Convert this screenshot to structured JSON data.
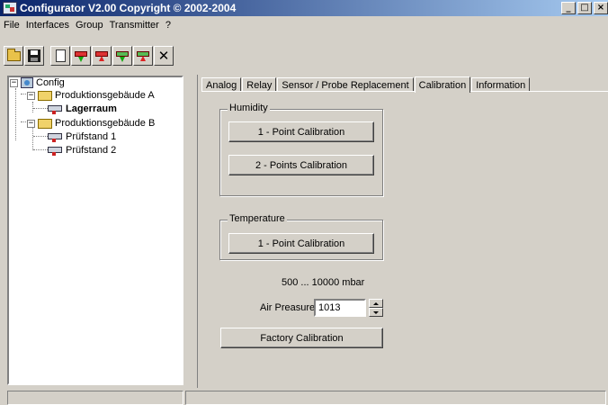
{
  "window": {
    "title": "Configurator  V2.00 Copyright © 2002-2004",
    "controls": {
      "minimize": "_",
      "maximize": "□",
      "close": "×"
    }
  },
  "menu": [
    "File",
    "Interfaces",
    "Group",
    "Transmitter",
    "?"
  ],
  "toolbar": {
    "buttons": [
      "open-folder-icon",
      "save-disk-icon",
      "new-document-icon",
      "download-device-icon",
      "upload-device-icon",
      "device-in-icon",
      "device-out-icon",
      "delete-icon"
    ]
  },
  "tree": {
    "root": {
      "label": "Config",
      "expander": "−"
    },
    "groups": [
      {
        "label": "Produktionsgebäude A",
        "expander": "−",
        "items": [
          {
            "label": "Lagerraum",
            "selected": true
          }
        ]
      },
      {
        "label": "Produktionsgebäude B",
        "expander": "−",
        "items": [
          {
            "label": "Prüfstand 1"
          },
          {
            "label": "Prüfstand 2"
          }
        ]
      }
    ]
  },
  "tabs": [
    {
      "label": "Analog",
      "active": false
    },
    {
      "label": "Relay",
      "active": false
    },
    {
      "label": "Sensor / Probe Replacement",
      "active": false
    },
    {
      "label": "Calibration",
      "active": true
    },
    {
      "label": "Information",
      "active": false
    }
  ],
  "calibration": {
    "humidity": {
      "title": "Humidity",
      "one_point": "1 - Point Calibration",
      "two_points": "2 - Points Calibration"
    },
    "temperature": {
      "title": "Temperature",
      "one_point": "1 - Point Calibration"
    },
    "pressure_range": "500 ... 10000 mbar",
    "air_pressure": {
      "label": "Air Preasure",
      "value": "1013"
    },
    "factory_button": "Factory Calibration"
  },
  "statusbar": {
    "panes": [
      "",
      ""
    ]
  }
}
